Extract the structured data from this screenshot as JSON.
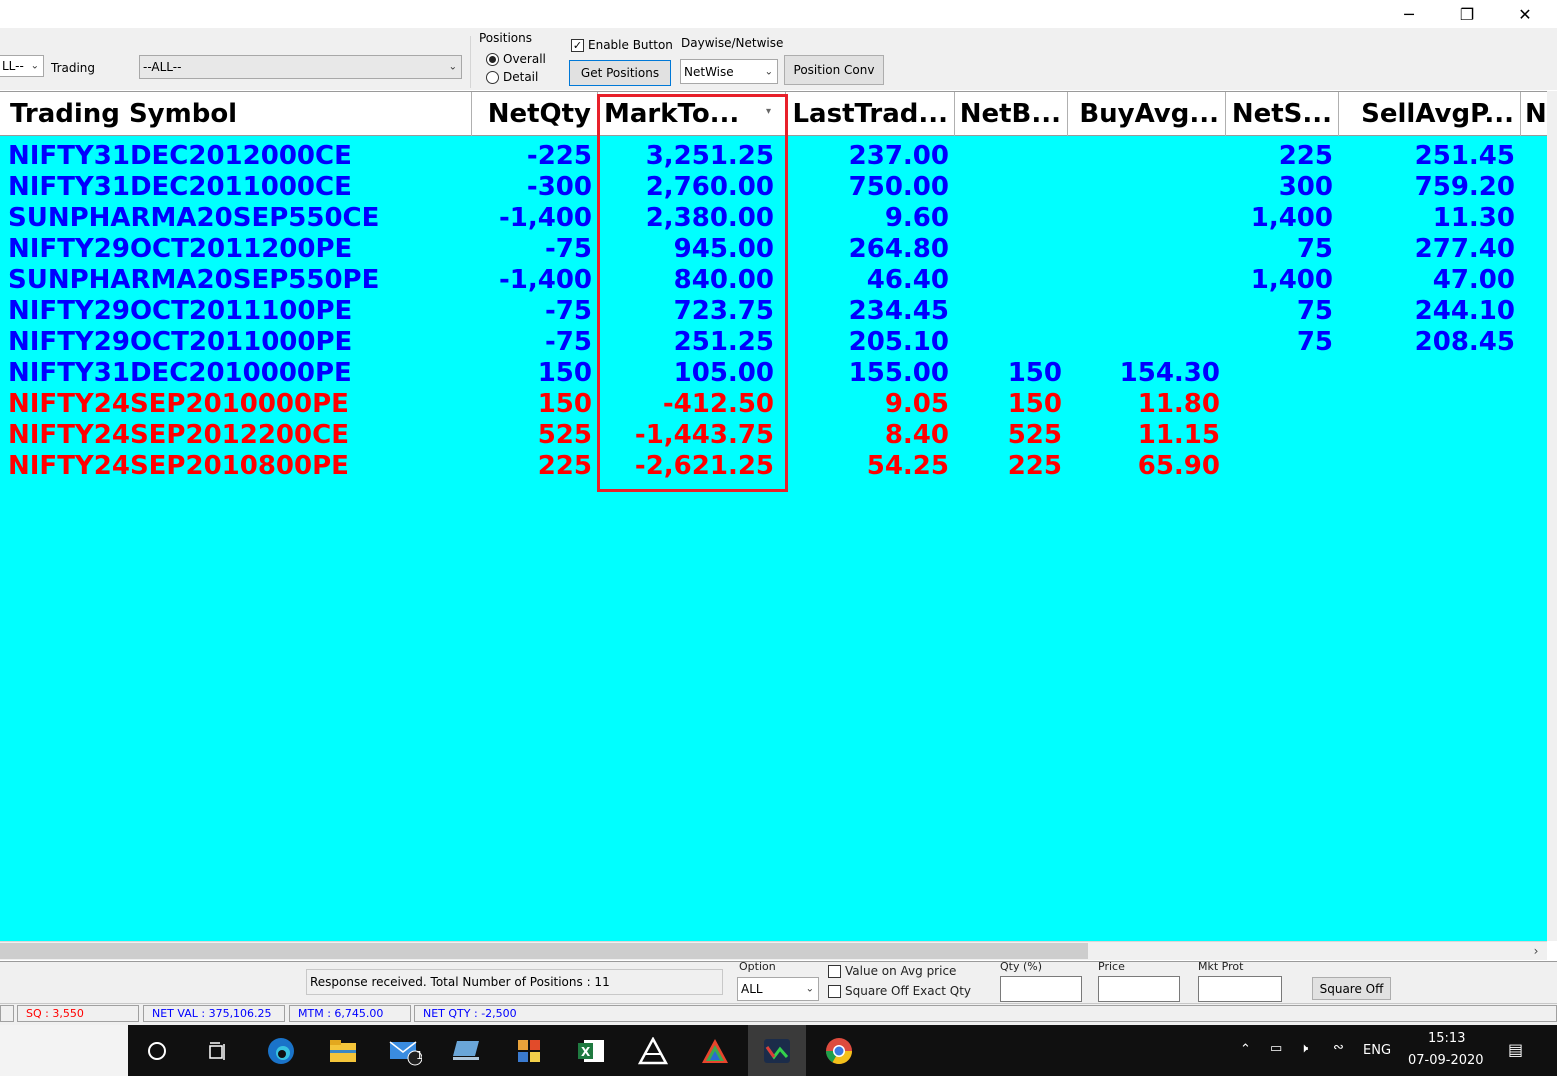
{
  "window": {
    "controls": {
      "minimize": "─",
      "restore": "❐",
      "close": "✕"
    }
  },
  "toolbar": {
    "exchange_combo": "LL--",
    "trading_label": "Trading",
    "trading_combo": "--ALL--",
    "positions_group_label": "Positions",
    "radio_overall": "Overall",
    "radio_detail": "Detail",
    "enable_button_label": "Enable Button",
    "get_positions_button": "Get Positions",
    "daywise_label": "Daywise/Netwise",
    "netwise_combo": "NetWise",
    "position_conv_button": "Position Conv"
  },
  "grid": {
    "columns": [
      "Trading Symbol",
      "NetQty",
      "MarkTo...",
      "LastTrad...",
      "NetB...",
      "BuyAvg...",
      "NetS...",
      "SellAvgP...",
      "N"
    ],
    "rows": [
      {
        "symbol": "NIFTY31DEC2012000CE",
        "netqty": "-225",
        "mtm": "3,251.25",
        "ltp": "237.00",
        "netbuy": "",
        "buyavg": "",
        "netsell": "225",
        "sellavg": "251.45",
        "color": "blue"
      },
      {
        "symbol": "NIFTY31DEC2011000CE",
        "netqty": "-300",
        "mtm": "2,760.00",
        "ltp": "750.00",
        "netbuy": "",
        "buyavg": "",
        "netsell": "300",
        "sellavg": "759.20",
        "color": "blue"
      },
      {
        "symbol": "SUNPHARMA20SEP550CE",
        "netqty": "-1,400",
        "mtm": "2,380.00",
        "ltp": "9.60",
        "netbuy": "",
        "buyavg": "",
        "netsell": "1,400",
        "sellavg": "11.30",
        "color": "blue"
      },
      {
        "symbol": "NIFTY29OCT2011200PE",
        "netqty": "-75",
        "mtm": "945.00",
        "ltp": "264.80",
        "netbuy": "",
        "buyavg": "",
        "netsell": "75",
        "sellavg": "277.40",
        "color": "blue"
      },
      {
        "symbol": "SUNPHARMA20SEP550PE",
        "netqty": "-1,400",
        "mtm": "840.00",
        "ltp": "46.40",
        "netbuy": "",
        "buyavg": "",
        "netsell": "1,400",
        "sellavg": "47.00",
        "color": "blue"
      },
      {
        "symbol": "NIFTY29OCT2011100PE",
        "netqty": "-75",
        "mtm": "723.75",
        "ltp": "234.45",
        "netbuy": "",
        "buyavg": "",
        "netsell": "75",
        "sellavg": "244.10",
        "color": "blue"
      },
      {
        "symbol": "NIFTY29OCT2011000PE",
        "netqty": "-75",
        "mtm": "251.25",
        "ltp": "205.10",
        "netbuy": "",
        "buyavg": "",
        "netsell": "75",
        "sellavg": "208.45",
        "color": "blue"
      },
      {
        "symbol": "NIFTY31DEC2010000PE",
        "netqty": "150",
        "mtm": "105.00",
        "ltp": "155.00",
        "netbuy": "150",
        "buyavg": "154.30",
        "netsell": "",
        "sellavg": "",
        "color": "blue"
      },
      {
        "symbol": "NIFTY24SEP2010000PE",
        "netqty": "150",
        "mtm": "-412.50",
        "ltp": "9.05",
        "netbuy": "150",
        "buyavg": "11.80",
        "netsell": "",
        "sellavg": "",
        "color": "red"
      },
      {
        "symbol": "NIFTY24SEP2012200CE",
        "netqty": "525",
        "mtm": "-1,443.75",
        "ltp": "8.40",
        "netbuy": "525",
        "buyavg": "11.15",
        "netsell": "",
        "sellavg": "",
        "color": "red"
      },
      {
        "symbol": "NIFTY24SEP2010800PE",
        "netqty": "225",
        "mtm": "-2,621.25",
        "ltp": "54.25",
        "netbuy": "225",
        "buyavg": "65.90",
        "netsell": "",
        "sellavg": "",
        "color": "red"
      }
    ]
  },
  "bottom": {
    "response_text": "Response received.  Total Number of Positions : 11",
    "option_label": "Option",
    "option_combo": "ALL",
    "value_on_avg_label": "Value on Avg  price",
    "square_off_exact_label": "Square Off Exact Qty",
    "qty_label": "Qty (%)",
    "price_label": "Price",
    "mkt_prot_label": "Mkt Prot",
    "square_off_button": "Square Off",
    "status": {
      "sq": "SQ : 3,550",
      "net_val": "NET VAL : 375,106.25",
      "mtm": "MTM : 6,745.00",
      "net_qty": "NET QTY : -2,500"
    }
  },
  "taskbar": {
    "icons": [
      "cortana-icon",
      "task-view-icon",
      "edge-icon",
      "file-explorer-icon",
      "mail-icon",
      "laptop-app-icon",
      "office-app-icon",
      "excel-icon",
      "triangle-app-icon",
      "prism-app-icon",
      "trading-app-icon",
      "chrome-icon"
    ],
    "mail_badge": "1",
    "language": "ENG",
    "time": "15:13",
    "date": "07-09-2020"
  },
  "colors": {
    "grid_background": "#00ffff",
    "profit_text": "#0000ff",
    "loss_text": "#ff0000",
    "highlight_border": "#e8202a"
  }
}
